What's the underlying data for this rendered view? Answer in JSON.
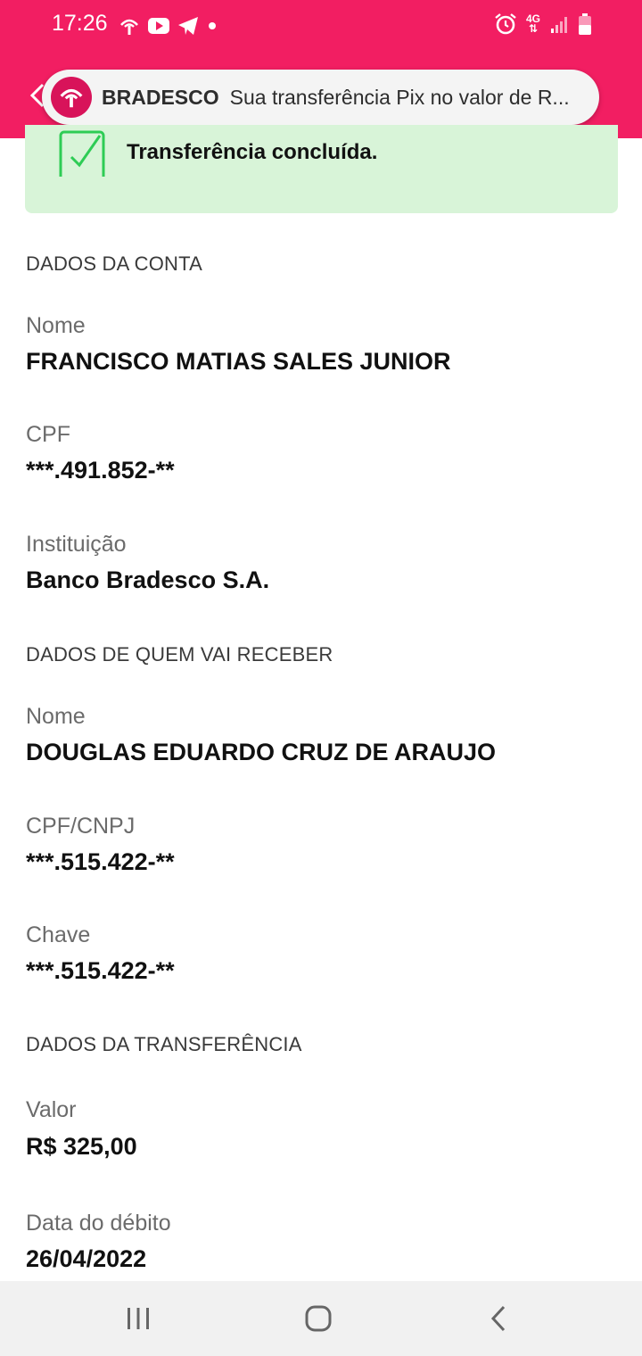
{
  "status_bar": {
    "time": "17:26",
    "network": "4G",
    "icons": [
      "bradesco-icon",
      "youtube-icon",
      "telegram-icon",
      "dot-icon",
      "alarm-icon",
      "signal-icon",
      "battery-icon"
    ]
  },
  "notification": {
    "app_name": "BRADESCO",
    "text": "Sua transferência Pix no valor de R..."
  },
  "success": {
    "message": "Transferência concluída."
  },
  "account": {
    "section_title": "DADOS DA CONTA",
    "name_label": "Nome",
    "name_value": "FRANCISCO MATIAS SALES JUNIOR",
    "cpf_label": "CPF",
    "cpf_value": "***.491.852-**",
    "institution_label": "Instituição",
    "institution_value": "Banco Bradesco S.A."
  },
  "receiver": {
    "section_title": "DADOS DE QUEM VAI RECEBER",
    "name_label": "Nome",
    "name_value": "DOUGLAS EDUARDO CRUZ DE ARAUJO",
    "doc_label": "CPF/CNPJ",
    "doc_value": "***.515.422-**",
    "key_label": "Chave",
    "key_value": "***.515.422-**"
  },
  "transfer": {
    "section_title": "DADOS DA TRANSFERÊNCIA",
    "amount_label": "Valor",
    "amount_value": "R$ 325,00",
    "date_label": "Data do débito",
    "date_value": "26/04/2022"
  },
  "colors": {
    "brand": "#f21e62",
    "success_bg": "#d8f4d8",
    "success_check": "#2ecc55"
  }
}
